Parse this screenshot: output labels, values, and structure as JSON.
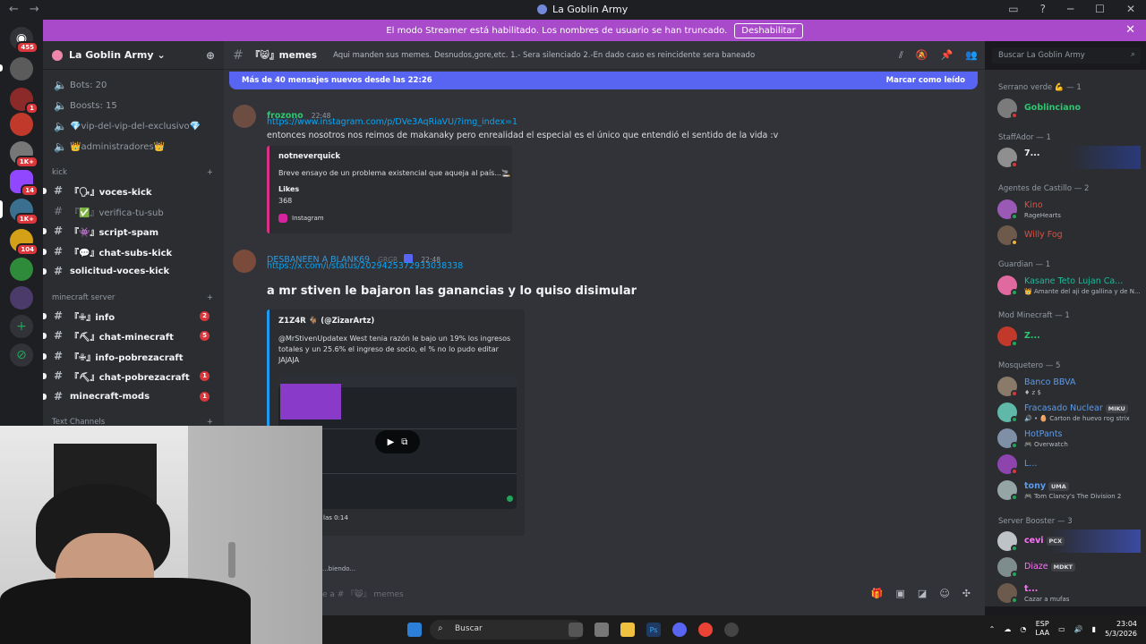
{
  "window": {
    "title": "La Goblin Army"
  },
  "banner": {
    "text": "El modo Streamer está habilitado. Los nombres de usuario se han truncado.",
    "button": "Deshabilitar"
  },
  "server_badges": [
    "455",
    "1",
    "1K+",
    "14",
    "1K+",
    "104"
  ],
  "guild": {
    "name": "La Goblin Army"
  },
  "sidebar": {
    "top_items": [
      "Bots: 20",
      "Boosts: 15",
      "💎vip-del-vip-del-exclusivo💎",
      "👑administradores👑"
    ],
    "category_kick": "kick",
    "kick_channels": [
      "『🗣』voces-kick",
      "『✅』verifica-tu-sub",
      "『👾』script-spam",
      "『💬』chat-subs-kick",
      "solicitud-voces-kick"
    ],
    "category_mc": "minecraft server",
    "mc_channels": [
      "『✙』info",
      "『⛏』chat-minecraft",
      "『✙』info-pobrezacraft",
      "『⛏』chat-pobrezacraft",
      "minecraft-mods"
    ],
    "mc_counts": [
      "2",
      "5",
      "",
      "1",
      "1"
    ],
    "category_text": "Text Channels"
  },
  "channel": {
    "name": "『😸』memes",
    "topic": "Aqui manden sus memes. Desnudos,gore,etc. 1.- Sera silenciado 2.-En dado caso es reincidente sera baneado"
  },
  "newbar": {
    "left": "Más de 40 mensajes nuevos desde las 22:26",
    "right": "Marcar como leído"
  },
  "messages": [
    {
      "author": "frozono",
      "time": "22:48",
      "link": "https://www.instagram.com/p/DVe3AqRiaVU/?img_index=1",
      "text": "entonces nosotros nos reimos de makanaky pero enrealidad el especial es el único que entendió el sentido de la vida :v",
      "embed": {
        "author": "notneverquick",
        "desc": "Breve ensayo de un problema existencial que aqueja al país...🚬",
        "field_name": "Likes",
        "field_value": "368",
        "footer": "Instagram"
      }
    },
    {
      "author": "DESBANEEN A BLANK69",
      "tag": "GRGR",
      "time": "22:48",
      "link": "https://x.com/i/status/2029425372933038338",
      "heading": "a mr stiven le bajaron las ganancias y lo quiso disimular",
      "embed": {
        "author": "Z1Z4R 🐐 (@ZizarArtz)",
        "desc": "@MrStivenUpdatex West tenia razón le bajo un 19% los ingresos totales y un 25.6% el ingreso de socio, el % no lo pudo editar JAJAJA",
        "footer": "las 0:14"
      }
    }
  ],
  "typing": "...biendo...",
  "input": {
    "placeholder": "e a # 『😸』 memes"
  },
  "members": {
    "search_placeholder": "Buscar La Goblin Army",
    "groups": [
      {
        "role": "Serrano verde 💪 — 1",
        "y": 0,
        "members": [
          {
            "name": "Goblinciano",
            "color": "#2dc770",
            "sub": ""
          }
        ]
      },
      {
        "role": "StaffAdor — 1",
        "members": [
          {
            "name": "7...",
            "color": "#f2f3f5",
            "sub": ""
          }
        ]
      },
      {
        "role": "Agentes de Castillo — 2",
        "members": [
          {
            "name": "Kino",
            "color": "#e74c3c",
            "sub": "RageHearts"
          },
          {
            "name": "Willy Fog",
            "color": "#e74c3c",
            "sub": ""
          }
        ]
      },
      {
        "role": "Guardian — 1",
        "members": [
          {
            "name": "Kasane Teto Lujan Ca...",
            "color": "#1abc9c",
            "sub": "👑 Amante del aji de gallina y de N..."
          }
        ]
      },
      {
        "role": "Mod Minecraft — 1",
        "members": [
          {
            "name": "Z...",
            "color": "#2dc770",
            "sub": ""
          }
        ]
      },
      {
        "role": "Mosquetero — 5",
        "members": [
          {
            "name": "Banco BBVA",
            "color": "#5d9cec",
            "sub": "♦ z $"
          },
          {
            "name": "Fracasado Nuclear",
            "color": "#5d9cec",
            "sub": "🔊 • 🥚 Carton de huevo rog strix",
            "tag": "MIKU"
          },
          {
            "name": "HotPants",
            "color": "#5d9cec",
            "sub": "🎮 Overwatch"
          },
          {
            "name": "L...",
            "color": "#5d9cec",
            "sub": ""
          },
          {
            "name": "tony",
            "color": "#5d9cec",
            "sub": "🎮 Tom Clancy's The Division 2",
            "tag": "UMA"
          }
        ]
      },
      {
        "role": "Server Booster — 3",
        "members": [
          {
            "name": "cevi",
            "color": "#ff73fa",
            "sub": "",
            "tag": "PCX"
          },
          {
            "name": "Diaze",
            "color": "#ff73fa",
            "sub": "",
            "tag": "MDKT"
          },
          {
            "name": "t...",
            "color": "#ff73fa",
            "sub": "Cazar a mufas"
          }
        ]
      }
    ]
  },
  "taskbar": {
    "search": "Buscar",
    "lang": "ESP",
    "lang2": "LAA",
    "time": "23:04",
    "date": "5/3/2026"
  },
  "colors": {
    "accent": "#5865f2",
    "banner": "#a84ac9",
    "link": "#00a8fc",
    "online": "#23a559"
  }
}
